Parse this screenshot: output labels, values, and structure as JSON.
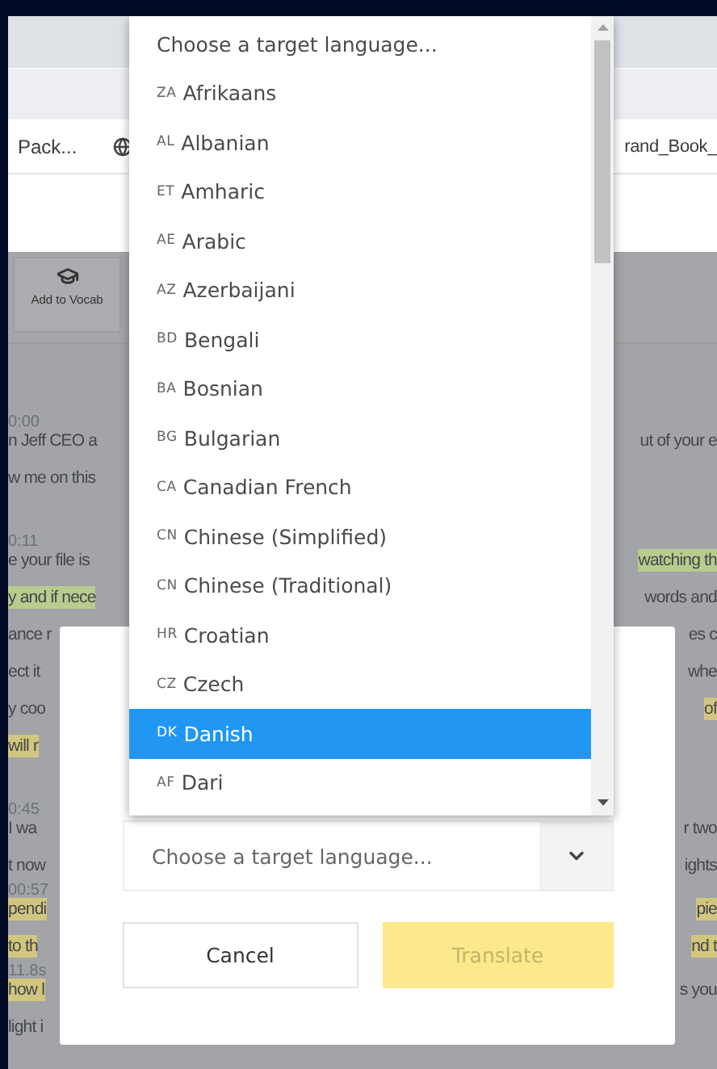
{
  "bookmarks": {
    "left": "Pack...",
    "right": "rand_Book_"
  },
  "toolbar": {
    "buttons": [
      {
        "label": "Add to Vocab"
      }
    ]
  },
  "transcript": {
    "paragraphs": [
      {
        "lines": [
          {
            "kind": "time",
            "text": "0:00"
          },
          {
            "kind": "text",
            "left": {
              "text": "n Jeff CEO a"
            },
            "right": {
              "text": "ut of your e"
            }
          },
          {
            "kind": "text",
            "left": {
              "text": "w me on this"
            }
          }
        ]
      },
      {
        "lines": [
          {
            "kind": "time",
            "text": "0:11"
          },
          {
            "kind": "text",
            "left": {
              "text": "e your file is"
            },
            "right": {
              "text": "watching th",
              "color": "#b8cc8e"
            }
          },
          {
            "kind": "text",
            "left": {
              "text": "y and if nece",
              "color": "#b8cc8e"
            },
            "right": {
              "text": "words and"
            }
          },
          {
            "kind": "text",
            "left": {
              "text": "ance r"
            },
            "right": {
              "text": "es c"
            }
          },
          {
            "kind": "text",
            "left": {
              "text": "ect it"
            },
            "right": {
              "text": "whe"
            }
          },
          {
            "kind": "text",
            "left": {
              "text": "y coo"
            },
            "right": {
              "text": "of",
              "color": "#d2c67e"
            }
          },
          {
            "kind": "text",
            "left": {
              "text": "will r",
              "color": "#d2c67e"
            }
          }
        ]
      },
      {
        "lines": [
          {
            "kind": "time",
            "text": "0:45"
          },
          {
            "kind": "text",
            "left": {
              "text": "I wa"
            },
            "right": {
              "text": "r two"
            }
          },
          {
            "kind": "text",
            "left": {
              "text": "t now"
            },
            "right": {
              "text": "ights"
            }
          },
          {
            "kind": "time",
            "text": "00:57"
          },
          {
            "kind": "text",
            "left": {
              "text": "pendi",
              "color": "#d2c67e"
            },
            "right": {
              "text": "pie",
              "color": "#d2c67e"
            }
          },
          {
            "kind": "text",
            "left": {
              "text": "to th",
              "color": "#d2c67e"
            },
            "right": {
              "text": "nd t",
              "color": "#d2c67e"
            }
          },
          {
            "kind": "time",
            "text": "11.8s"
          },
          {
            "kind": "text",
            "left": {
              "text": "how l",
              "color": "#d2c67e"
            },
            "right": {
              "text": "s you"
            }
          },
          {
            "kind": "text",
            "left": {
              "text": "light i"
            }
          }
        ]
      }
    ]
  },
  "modal": {
    "select": {
      "placeholder": "Choose a target language..."
    },
    "buttons": [
      {
        "label": "Cancel",
        "kind": "secondary"
      },
      {
        "label": "Translate",
        "kind": "primary"
      }
    ]
  },
  "dropdown": {
    "options": [
      {
        "label": "Choose a target language...",
        "selected": false
      },
      {
        "code": "ZA",
        "label": "Afrikaans",
        "selected": false
      },
      {
        "code": "AL",
        "label": "Albanian",
        "selected": false
      },
      {
        "code": "ET",
        "label": "Amharic",
        "selected": false
      },
      {
        "code": "AE",
        "label": "Arabic",
        "selected": false
      },
      {
        "code": "AZ",
        "label": "Azerbaijani",
        "selected": false
      },
      {
        "code": "BD",
        "label": "Bengali",
        "selected": false
      },
      {
        "code": "BA",
        "label": "Bosnian",
        "selected": false
      },
      {
        "code": "BG",
        "label": "Bulgarian",
        "selected": false
      },
      {
        "code": "CA",
        "label": "Canadian French",
        "selected": false
      },
      {
        "code": "CN",
        "label": "Chinese (Simplified)",
        "selected": false
      },
      {
        "code": "CN",
        "label": "Chinese (Traditional)",
        "selected": false
      },
      {
        "code": "HR",
        "label": "Croatian",
        "selected": false
      },
      {
        "code": "CZ",
        "label": "Czech",
        "selected": false
      },
      {
        "code": "DK",
        "label": "Danish",
        "selected": true
      },
      {
        "code": "AF",
        "label": "Dari",
        "selected": false
      }
    ]
  }
}
